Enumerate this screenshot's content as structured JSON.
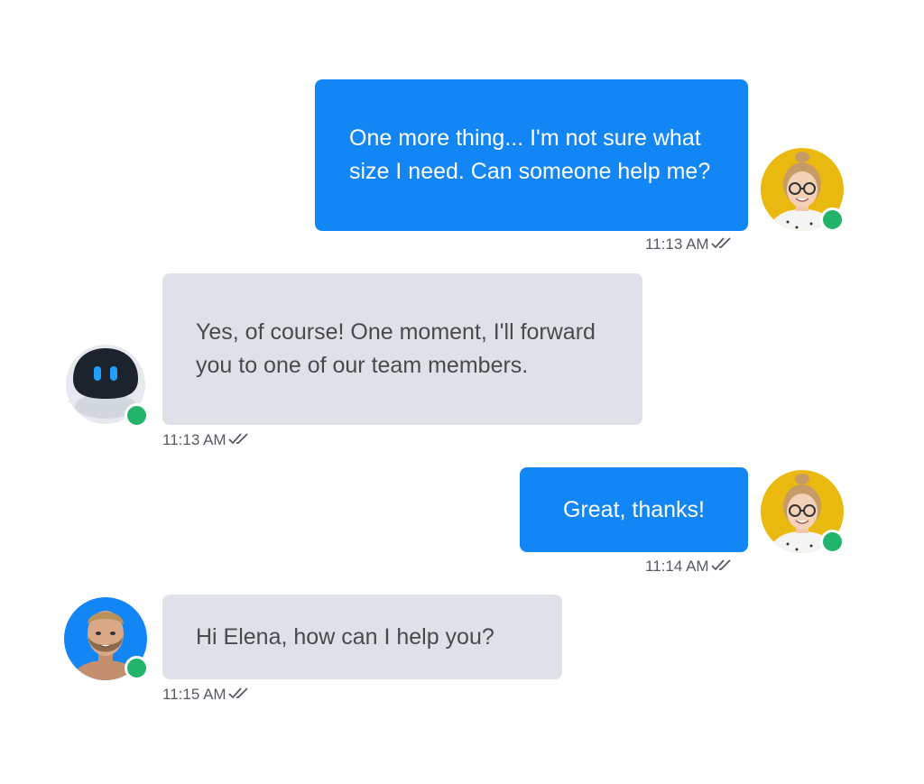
{
  "messages": [
    {
      "direction": "outgoing",
      "sender": "customer",
      "text": "One more thing... I'm not sure what size I need. Can someone help me?",
      "time": "11:13 AM",
      "status_icon": "double-check-icon"
    },
    {
      "direction": "incoming",
      "sender": "bot",
      "text": "Yes, of course! One moment, I'll forward you to one of our team members.",
      "time": "11:13 AM",
      "status_icon": "double-check-icon"
    },
    {
      "direction": "outgoing",
      "sender": "customer",
      "text": "Great, thanks!",
      "time": "11:14 AM",
      "status_icon": "double-check-icon"
    },
    {
      "direction": "incoming",
      "sender": "agent",
      "text": "Hi Elena, how can I help you?",
      "time": "11:15 AM",
      "status_icon": "double-check-icon"
    }
  ],
  "colors": {
    "outgoing_bubble": "#1386f5",
    "incoming_bubble": "#dfe1e8",
    "online_status": "#22b46b",
    "customer_avatar_bg": "#e9b90f",
    "agent_avatar_bg": "#1386f5"
  }
}
